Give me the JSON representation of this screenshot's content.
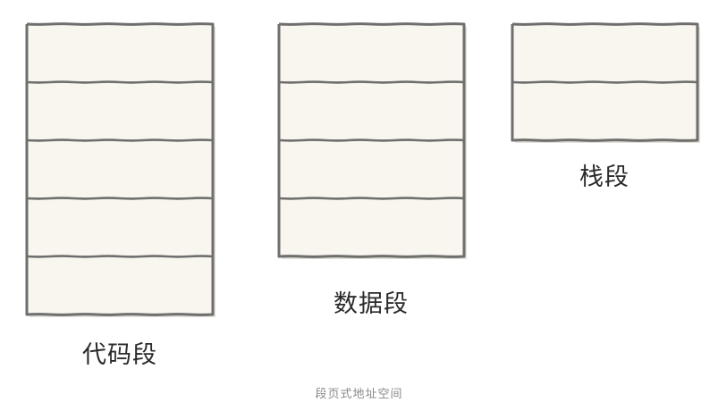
{
  "segments": [
    {
      "id": "code",
      "label": "代码段",
      "blocks": 5
    },
    {
      "id": "data",
      "label": "数据段",
      "blocks": 4
    },
    {
      "id": "stack",
      "label": "栈段",
      "blocks": 2
    }
  ],
  "caption": "段页式地址空间",
  "colors": {
    "fill": "#f8f6ee",
    "stroke": "#6e6e6e",
    "shadow": "#cfcbbd"
  }
}
